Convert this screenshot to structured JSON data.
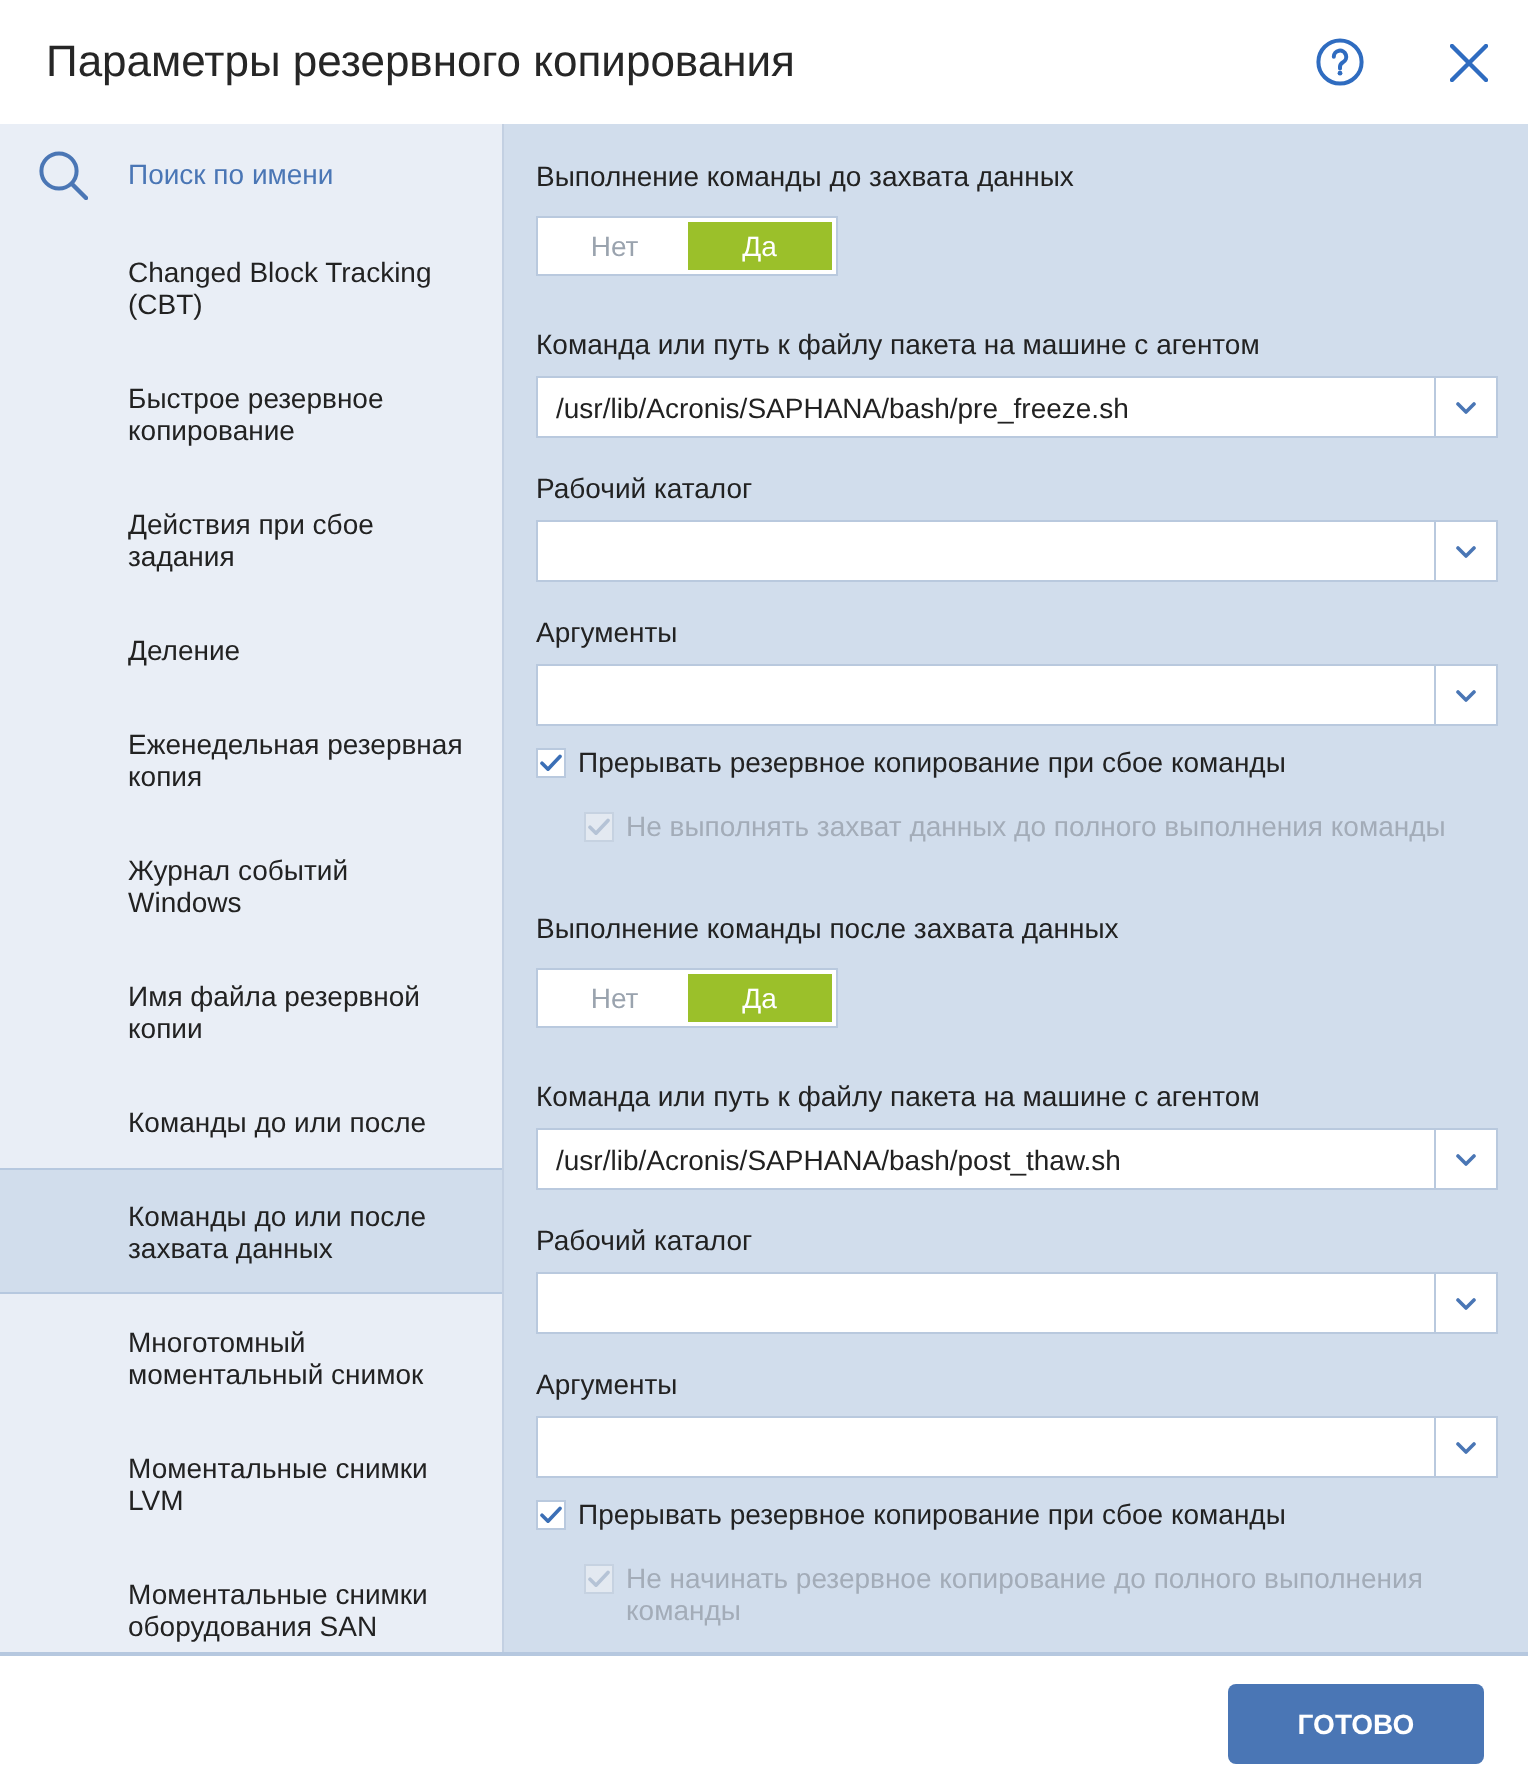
{
  "window": {
    "title": "Параметры резервного копирования"
  },
  "sidebar": {
    "search": {
      "placeholder": "Поиск по имени"
    },
    "items": [
      {
        "label": "Changed Block Tracking (CBT)",
        "selected": false
      },
      {
        "label": "Быстрое резервное копирование",
        "selected": false
      },
      {
        "label": "Действия при сбое задания",
        "selected": false
      },
      {
        "label": "Деление",
        "selected": false
      },
      {
        "label": "Еженедельная резервная копия",
        "selected": false
      },
      {
        "label": "Журнал событий Windows",
        "selected": false
      },
      {
        "label": "Имя файла резервной копии",
        "selected": false
      },
      {
        "label": "Команды до или после",
        "selected": false
      },
      {
        "label": "Команды до или после захвата данных",
        "selected": true
      },
      {
        "label": "Многотомный моментальный снимок",
        "selected": false
      },
      {
        "label": "Моментальные снимки LVM",
        "selected": false
      },
      {
        "label": "Моментальные снимки оборудования SAN",
        "selected": false
      }
    ]
  },
  "sections": [
    {
      "title": "Выполнение команды до захвата данных",
      "toggle": [
        {
          "label": "Нет",
          "selected": false
        },
        {
          "label": "Да",
          "selected": true
        }
      ],
      "fields": [
        {
          "label": "Команда или путь к файлу пакета на машине с агентом",
          "value": "/usr/lib/Acronis/SAPHANA/bash/pre_freeze.sh"
        },
        {
          "label": "Рабочий каталог"
        },
        {
          "label": "Аргументы"
        }
      ],
      "checkboxes": [
        {
          "label": "Прерывать резервное копирование при сбое команды",
          "checked": true,
          "disabled": false,
          "children": [
            {
              "label": "Не выполнять захват данных до полного выполнения команды",
              "checked": true,
              "disabled": true
            }
          ]
        }
      ]
    },
    {
      "title": "Выполнение команды после захвата данных",
      "toggle": [
        {
          "label": "Нет",
          "selected": false
        },
        {
          "label": "Да",
          "selected": true
        }
      ],
      "fields": [
        {
          "label": "Команда или путь к файлу пакета на машине с агентом",
          "value": "/usr/lib/Acronis/SAPHANA/bash/post_thaw.sh"
        },
        {
          "label": "Рабочий каталог"
        },
        {
          "label": "Аргументы"
        }
      ],
      "checkboxes": [
        {
          "label": "Прерывать резервное копирование при сбое команды",
          "checked": true,
          "disabled": false,
          "children": [
            {
              "label": "Не начинать резервное копирование до полного выполнения команды",
              "checked": true,
              "disabled": true
            }
          ]
        }
      ]
    }
  ],
  "footer": {
    "buttons": [
      {
        "label": "ГОТОВО"
      }
    ]
  }
}
